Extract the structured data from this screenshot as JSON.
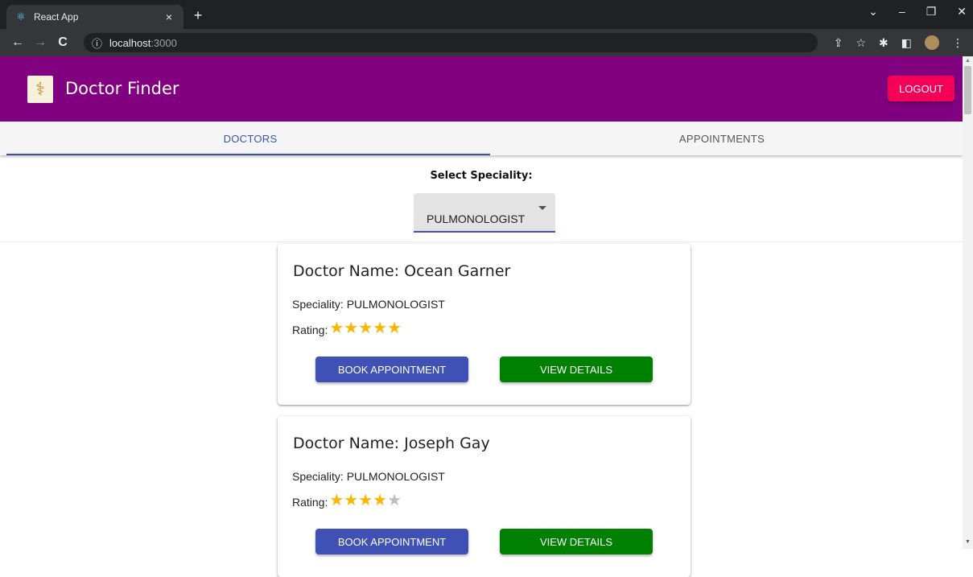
{
  "browser": {
    "tab_title": "React App",
    "tab_close": "×",
    "new_tab": "+",
    "url_host": "localhost",
    "url_port": ":3000",
    "nav": {
      "back": "←",
      "forward": "→",
      "reload": "C"
    },
    "window_controls": {
      "dropdown": "⌄",
      "minimize": "–",
      "restore": "❐",
      "close": "✕"
    },
    "icons": [
      "share-icon",
      "star-icon",
      "extensions-icon",
      "sidepanel-icon",
      "profile-avatar",
      "menu-icon"
    ]
  },
  "app": {
    "title": "Doctor Finder",
    "logout_label": "LOGOUT",
    "brand_color": "#800080",
    "accent_color": "#3f51b5",
    "logout_color": "#f50057"
  },
  "tabs": [
    {
      "label": "DOCTORS",
      "active": true
    },
    {
      "label": "APPOINTMENTS",
      "active": false
    }
  ],
  "filter": {
    "label": "Select Speciality:",
    "selected": "PULMONOLOGIST"
  },
  "doctors": [
    {
      "name": "Doctor Name: Ocean Garner",
      "speciality": "Speciality: PULMONOLOGIST",
      "rating_label": "Rating:",
      "rating": 5,
      "rating_max": 5,
      "book_label": "BOOK APPOINTMENT",
      "view_label": "VIEW DETAILS"
    },
    {
      "name": "Doctor Name: Joseph Gay",
      "speciality": "Speciality: PULMONOLOGIST",
      "rating_label": "Rating:",
      "rating": 4,
      "rating_max": 5,
      "book_label": "BOOK APPOINTMENT",
      "view_label": "VIEW DETAILS"
    }
  ]
}
